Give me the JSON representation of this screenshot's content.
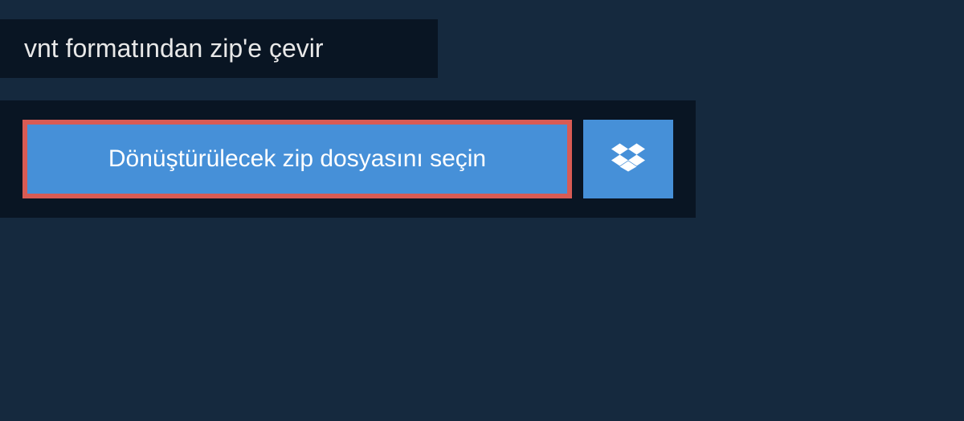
{
  "header": {
    "title": "vnt formatından zip'e çevir"
  },
  "upload": {
    "select_file_label": "Dönüştürülecek zip dosyasını seçin"
  },
  "icons": {
    "dropbox": "dropbox-icon"
  }
}
